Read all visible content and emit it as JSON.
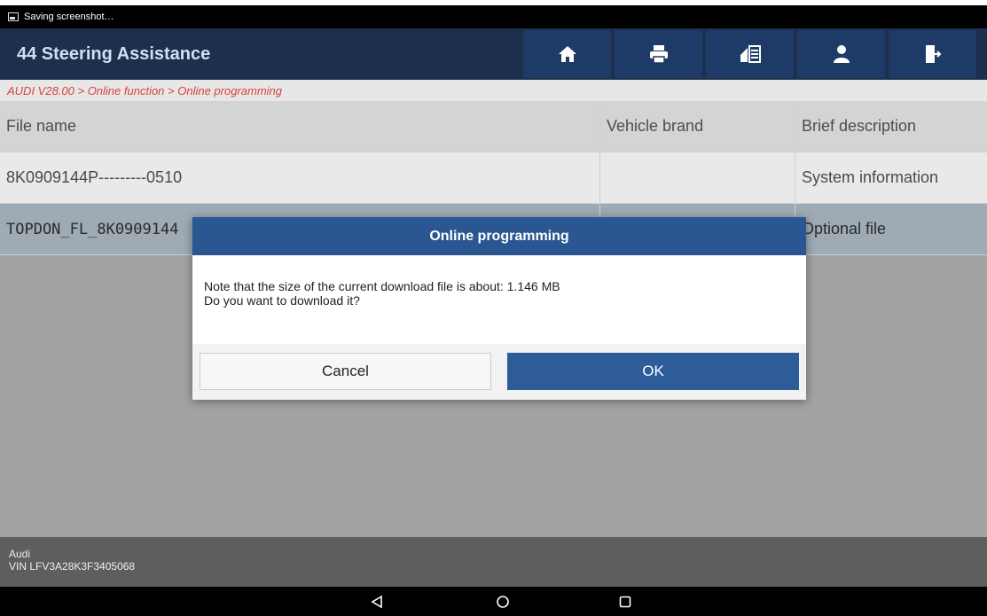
{
  "statusbar": {
    "notification": "Saving screenshot…",
    "icon": "screenshot-icon"
  },
  "header": {
    "title": "44 Steering Assistance",
    "toolbar": [
      {
        "name": "home",
        "icon": "home-icon",
        "glyph": "🏠"
      },
      {
        "name": "print",
        "icon": "print-icon",
        "glyph": "🖶"
      },
      {
        "name": "report",
        "icon": "report-icon",
        "glyph": "▤"
      },
      {
        "name": "user",
        "icon": "user-icon",
        "glyph": "👤"
      },
      {
        "name": "exit",
        "icon": "exit-icon",
        "glyph": "⇥"
      }
    ]
  },
  "breadcrumb": "AUDI V28.00 > Online function > Online programming",
  "table": {
    "columns": [
      "File name",
      "Vehicle brand",
      "Brief description"
    ],
    "rows": [
      {
        "file": "8K0909144P---------0510",
        "brand": "",
        "desc": "System information"
      },
      {
        "file": "TOPDON_FL_8K0909144",
        "brand": "",
        "desc": "Optional file"
      }
    ]
  },
  "footer": {
    "make": "Audi",
    "vin": "VIN LFV3A28K3F3405068"
  },
  "navbar": {
    "back": "◁",
    "home": "○",
    "recents": "□"
  },
  "dialog": {
    "title": "Online programming",
    "line1": "Note that the size of the current download file is about: 1.146 MB",
    "line2": "Do you want to download it?",
    "cancel": "Cancel",
    "ok": "OK"
  },
  "colors": {
    "header": "#1d2f4d",
    "toolbar_button": "#1e3a66",
    "breadcrumb_text": "#d9413a",
    "dialog_title": "#2a5791",
    "ok_button": "#2d5c98"
  }
}
